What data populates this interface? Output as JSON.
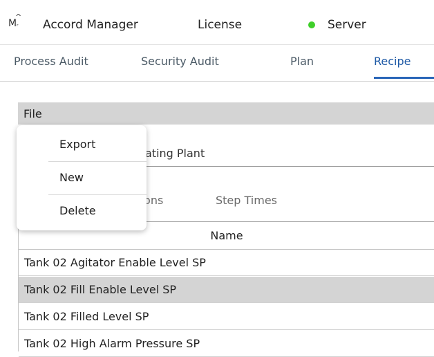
{
  "topbar": {
    "logo_text": "M",
    "app_name": "Accord Manager",
    "license": "License",
    "server": "Server",
    "server_status_color": "#3fcf2a"
  },
  "tabs": [
    {
      "label": "Process Audit"
    },
    {
      "label": "Security Audit"
    },
    {
      "label": "Plan"
    },
    {
      "label": "Recipe"
    }
  ],
  "file_menu": {
    "label": "File",
    "items": [
      {
        "label": "Export"
      },
      {
        "label": "New"
      },
      {
        "label": "Delete"
      }
    ]
  },
  "plant": {
    "label": "ating Plant"
  },
  "subtabs": [
    {
      "label": "cisions"
    },
    {
      "label": "Step Times"
    }
  ],
  "grid": {
    "column_header": "Name",
    "rows": [
      {
        "name": "Tank 02 Agitator Enable Level SP"
      },
      {
        "name": "Tank 02 Fill Enable Level SP"
      },
      {
        "name": "Tank 02 Filled Level SP"
      },
      {
        "name": "Tank 02 High Alarm Pressure SP"
      }
    ],
    "selected_row_index": 1
  },
  "colors": {
    "active_tab": "#1f5aa6",
    "selected_row": "#d4d4d4",
    "file_bar": "#d4d4d4"
  }
}
